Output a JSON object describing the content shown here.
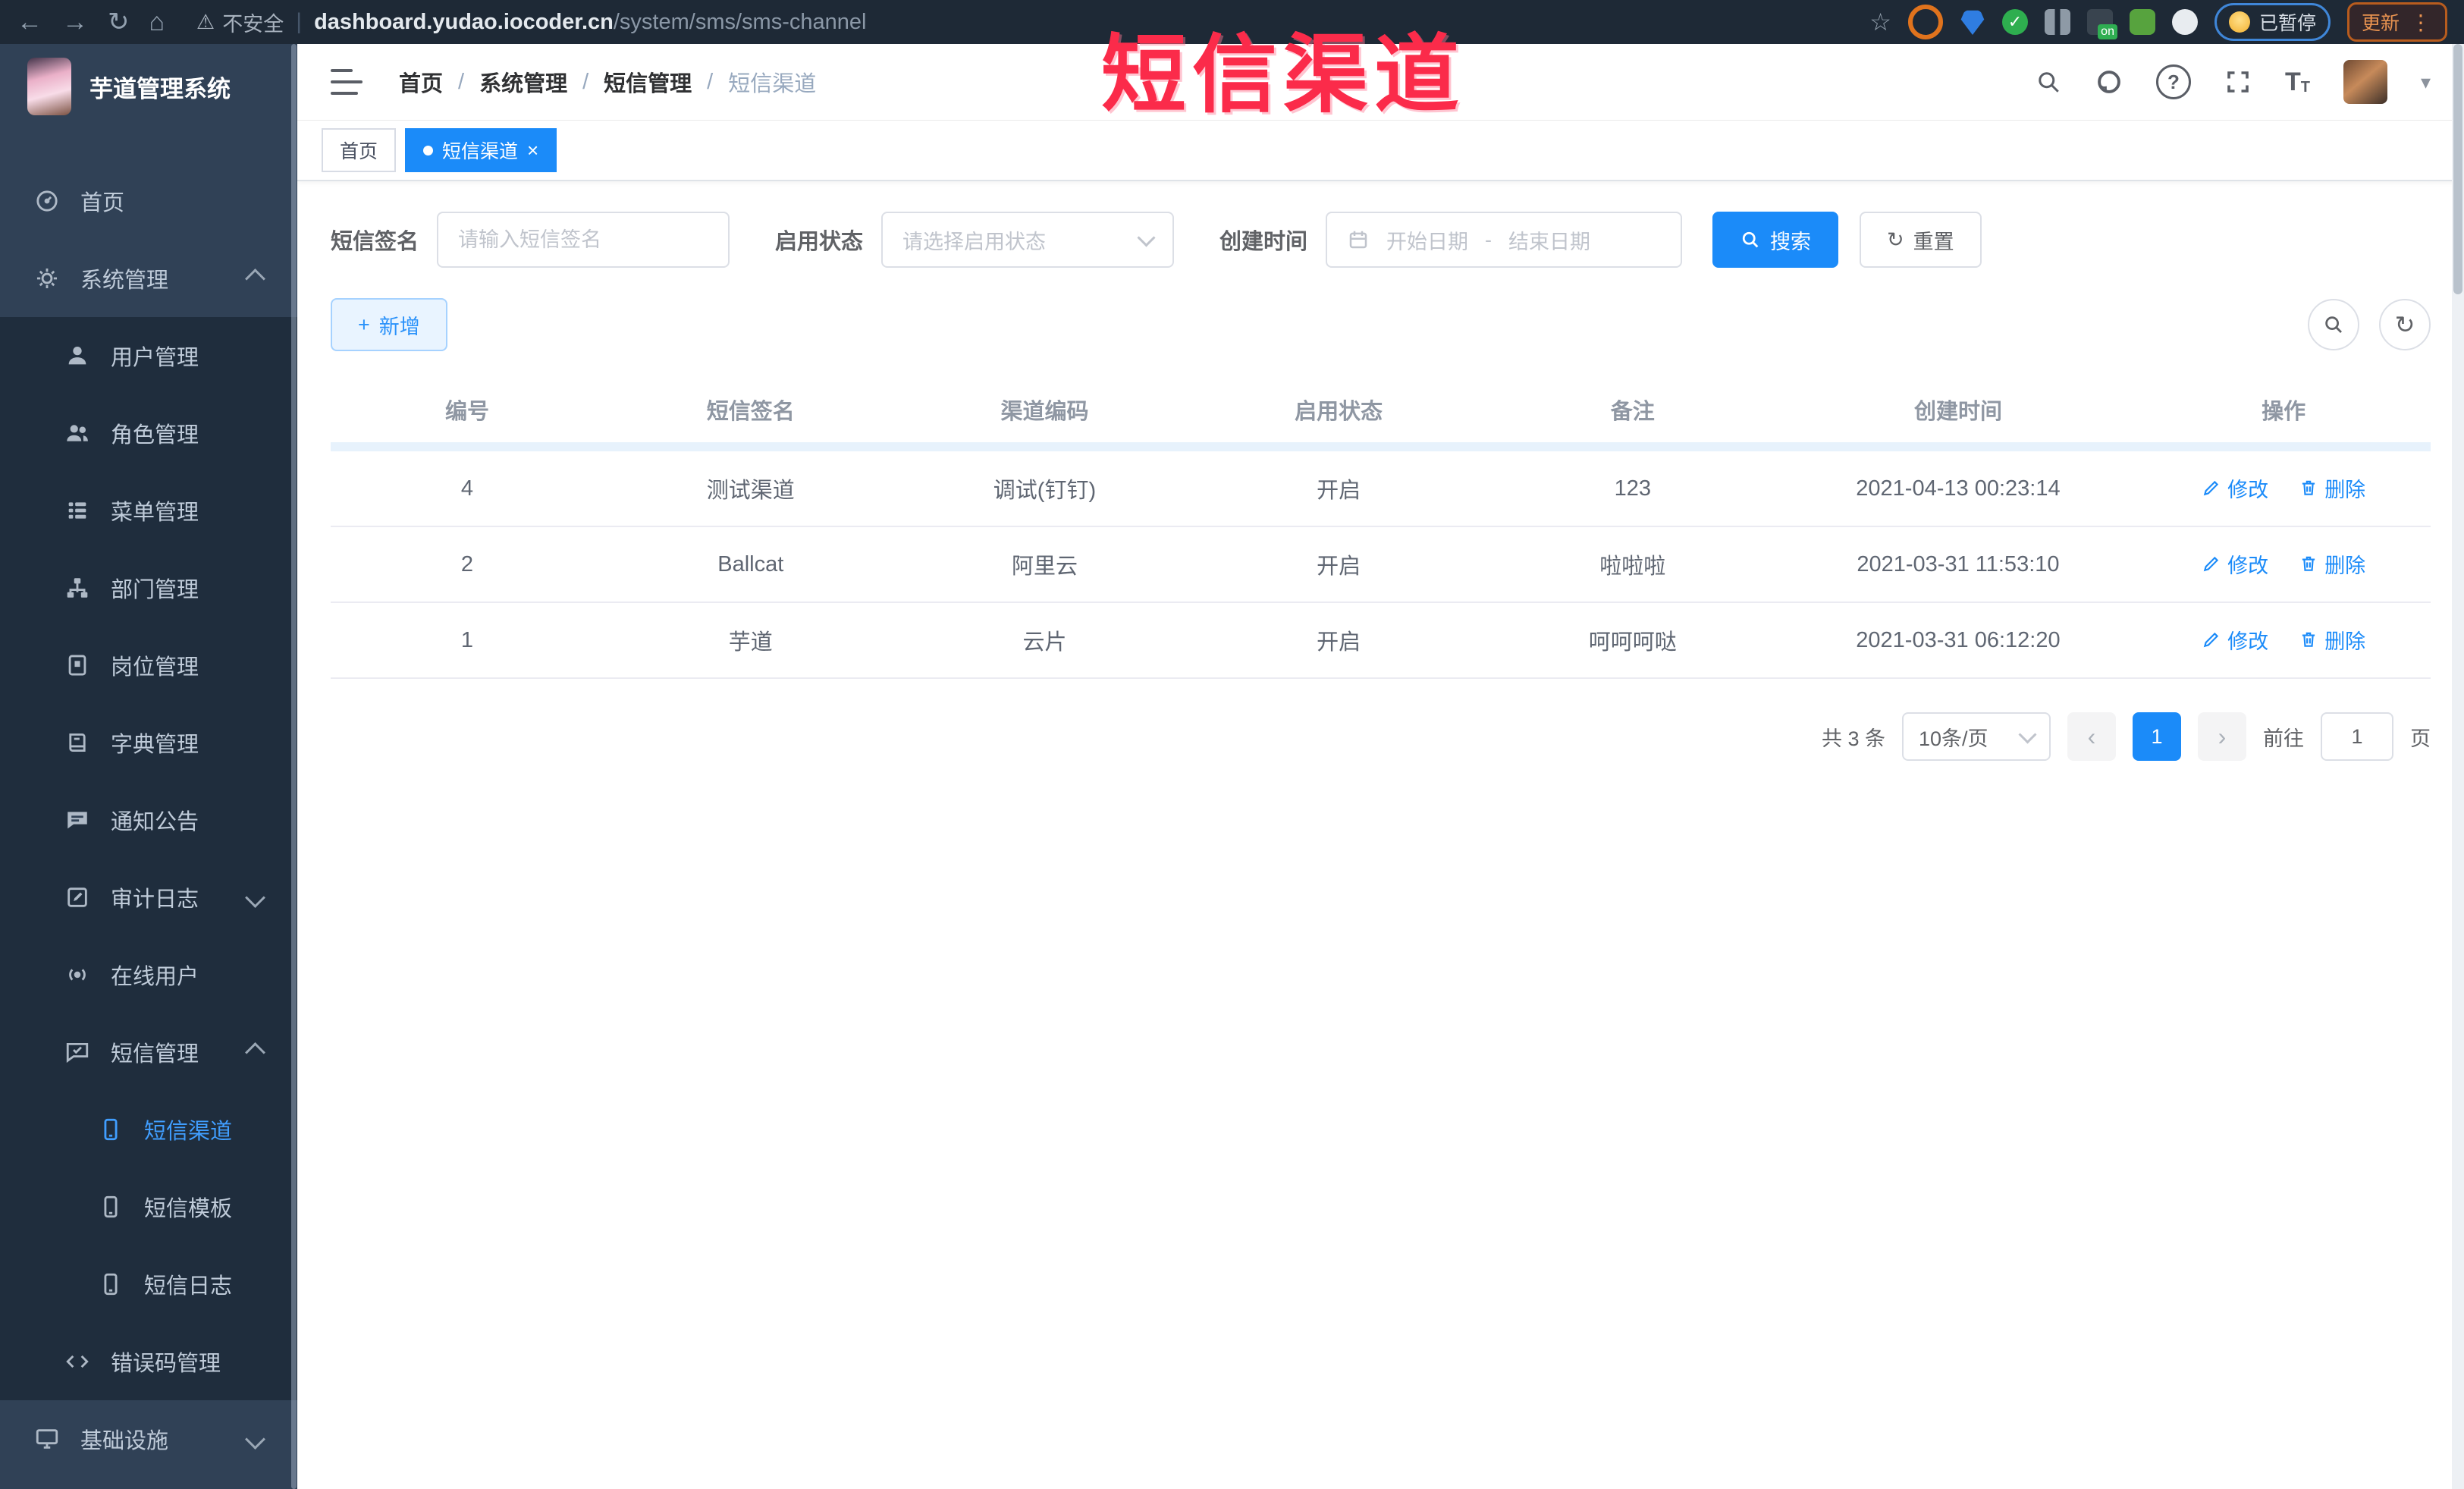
{
  "watermark": "短信渠道",
  "colors": {
    "accent": "#1b8bf9",
    "sidebar_bg": "#304156",
    "submenu_bg": "#1f2d3d",
    "watermark_red": "#fb2b4a",
    "active_menu": "#409eff"
  },
  "icons": {
    "back": "←",
    "forward": "→",
    "reload": "↻",
    "home": "⌂",
    "warning": "⚠",
    "star": "☆",
    "check": "✓",
    "caret": "▾",
    "close": "×",
    "dot": "●",
    "plus": "+",
    "prev": "‹",
    "next": "›",
    "menu_dots": "⋮",
    "question": "?",
    "refresh": "↻",
    "font_big": "T",
    "font_small": "T",
    "ext_on": "on",
    "range_dash": "-"
  },
  "browser": {
    "security_label": "不安全",
    "url_domain": "dashboard.yudao.iocoder.cn",
    "url_path": "/system/sms/sms-channel",
    "paused_label": "已暂停",
    "update_label": "更新"
  },
  "sidebar": {
    "app_title": "芋道管理系统",
    "items": [
      {
        "label": "首页",
        "icon": "dashboard-icon"
      },
      {
        "label": "系统管理",
        "icon": "gear-icon"
      },
      {
        "label": "用户管理",
        "icon": "user-icon"
      },
      {
        "label": "角色管理",
        "icon": "users-icon"
      },
      {
        "label": "菜单管理",
        "icon": "menu-list-icon"
      },
      {
        "label": "部门管理",
        "icon": "org-tree-icon"
      },
      {
        "label": "岗位管理",
        "icon": "post-badge-icon"
      },
      {
        "label": "字典管理",
        "icon": "dictionary-icon"
      },
      {
        "label": "通知公告",
        "icon": "announcement-icon"
      },
      {
        "label": "审计日志",
        "icon": "audit-log-icon"
      },
      {
        "label": "在线用户",
        "icon": "online-users-icon"
      },
      {
        "label": "短信管理",
        "icon": "sms-icon"
      },
      {
        "label": "短信渠道",
        "icon": "phone-icon",
        "active": true
      },
      {
        "label": "短信模板",
        "icon": "phone-icon"
      },
      {
        "label": "短信日志",
        "icon": "phone-icon"
      },
      {
        "label": "错误码管理",
        "icon": "code-icon"
      },
      {
        "label": "基础设施",
        "icon": "infrastructure-icon"
      }
    ]
  },
  "navbar": {
    "separator": "/",
    "breadcrumb": [
      {
        "label": "首页"
      },
      {
        "label": "系统管理"
      },
      {
        "label": "短信管理"
      },
      {
        "label": "短信渠道"
      }
    ]
  },
  "tabs": [
    {
      "label": "首页"
    },
    {
      "label": "短信渠道"
    }
  ],
  "filters": {
    "sign_label": "短信签名",
    "sign_placeholder": "请输入短信签名",
    "status_label": "启用状态",
    "status_placeholder": "请选择启用状态",
    "time_label": "创建时间",
    "start_placeholder": "开始日期",
    "range_separator": "-",
    "end_placeholder": "结束日期",
    "search_label": "搜索",
    "reset_label": "重置"
  },
  "toolbar": {
    "add_label": "新增"
  },
  "table": {
    "columns": [
      "编号",
      "短信签名",
      "渠道编码",
      "启用状态",
      "备注",
      "创建时间",
      "操作"
    ],
    "edit_label": "修改",
    "delete_label": "删除",
    "rows": [
      {
        "id": "4",
        "sign": "测试渠道",
        "code": "调试(钉钉)",
        "status": "开启",
        "remark": "123",
        "created": "2021-04-13 00:23:14"
      },
      {
        "id": "2",
        "sign": "Ballcat",
        "code": "阿里云",
        "status": "开启",
        "remark": "啦啦啦",
        "created": "2021-03-31 11:53:10"
      },
      {
        "id": "1",
        "sign": "芋道",
        "code": "云片",
        "status": "开启",
        "remark": "呵呵呵哒",
        "created": "2021-03-31 06:12:20"
      }
    ]
  },
  "pagination": {
    "total_label": "共 3 条",
    "page_size_label": "10条/页",
    "current_page": "1",
    "goto_label": "前往",
    "goto_value": "1",
    "unit_label": "页"
  }
}
